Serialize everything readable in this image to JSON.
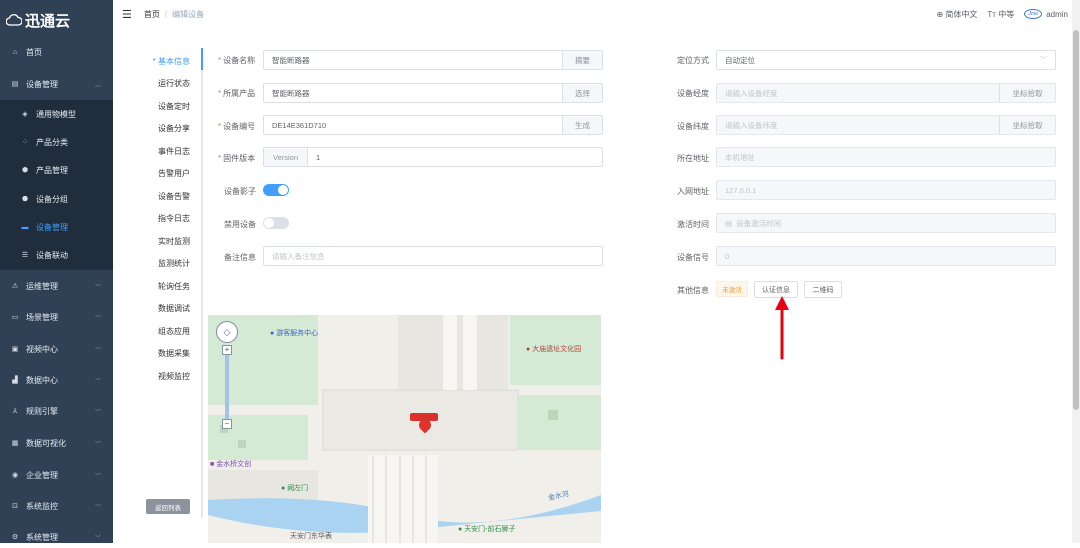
{
  "app": {
    "title": "迅通云"
  },
  "sidebar": {
    "items": [
      {
        "label": "首页",
        "icon": "home-icon"
      },
      {
        "label": "设备管理",
        "icon": "device-icon"
      },
      {
        "label": "通用物模型",
        "icon": "model-icon"
      },
      {
        "label": "产品分类",
        "icon": "category-icon"
      },
      {
        "label": "产品管理",
        "icon": "product-icon"
      },
      {
        "label": "设备分组",
        "icon": "group-icon"
      },
      {
        "label": "设备管理",
        "icon": "device-manage-icon"
      },
      {
        "label": "设备联动",
        "icon": "linkage-icon"
      },
      {
        "label": "运维管理",
        "icon": "ops-icon"
      },
      {
        "label": "场景管理",
        "icon": "scene-icon"
      },
      {
        "label": "视频中心",
        "icon": "video-icon"
      },
      {
        "label": "数据中心",
        "icon": "data-icon"
      },
      {
        "label": "规则引擎",
        "icon": "rule-icon"
      },
      {
        "label": "数据可视化",
        "icon": "visual-icon"
      },
      {
        "label": "企业管理",
        "icon": "enterprise-icon"
      },
      {
        "label": "系统监控",
        "icon": "monitor-icon"
      },
      {
        "label": "系统管理",
        "icon": "system-icon"
      }
    ]
  },
  "header": {
    "breadcrumb": [
      "首页",
      "编辑设备"
    ],
    "language": "简体中文",
    "font_size": "中等",
    "user": "admin"
  },
  "tabs": [
    "* 基本信息",
    "运行状态",
    "设备定时",
    "设备分享",
    "事件日志",
    "告警用户",
    "设备告警",
    "指令日志",
    "实时监测",
    "监测统计",
    "轮询任务",
    "数据调试",
    "组态应用",
    "数据采集",
    "视频监控"
  ],
  "form_left": {
    "device_name": {
      "label": "设备名称",
      "value": "智能断路器",
      "append": "摘要"
    },
    "product": {
      "label": "所属产品",
      "value": "智能断路器",
      "append": "选择"
    },
    "serial": {
      "label": "设备编号",
      "value": "DE14E361D710",
      "append": "生成"
    },
    "firmware": {
      "label": "固件版本",
      "prepend": "Version",
      "value": "1"
    },
    "shadow": {
      "label": "设备影子",
      "on": true
    },
    "disable": {
      "label": "禁用设备",
      "on": false
    },
    "remark": {
      "label": "备注信息",
      "placeholder": "请输入备注信息"
    }
  },
  "form_right": {
    "locate_mode": {
      "label": "定位方式",
      "value": "自动定位"
    },
    "longitude": {
      "label": "设备经度",
      "placeholder": "请输入设备经度",
      "append": "坐标拾取"
    },
    "latitude": {
      "label": "设备纬度",
      "placeholder": "请输入设备纬度",
      "append": "坐标拾取"
    },
    "address": {
      "label": "所在地址",
      "placeholder": "本机地址"
    },
    "ip": {
      "label": "入网地址",
      "value": "127.0.0.1"
    },
    "activate_time": {
      "label": "激活时间",
      "placeholder": "设备激活时间"
    },
    "signal": {
      "label": "设备信号",
      "value": "0"
    },
    "other": {
      "label": "其他信息",
      "status_tag": "未激活",
      "auth_button": "认证信息",
      "qr_button": "二维码"
    }
  },
  "map": {
    "labels": [
      "游客服务中心",
      "大庙遗址文化园",
      "金水桥文创",
      "阙左门",
      "天安门-前石狮子",
      "天安门东华表",
      "金水河"
    ]
  },
  "back_button": "返回列表",
  "colors": {
    "primary": "#409eff",
    "sidebar_bg": "#304156",
    "arrow": "#e60012",
    "warning": "#e6a23c"
  }
}
